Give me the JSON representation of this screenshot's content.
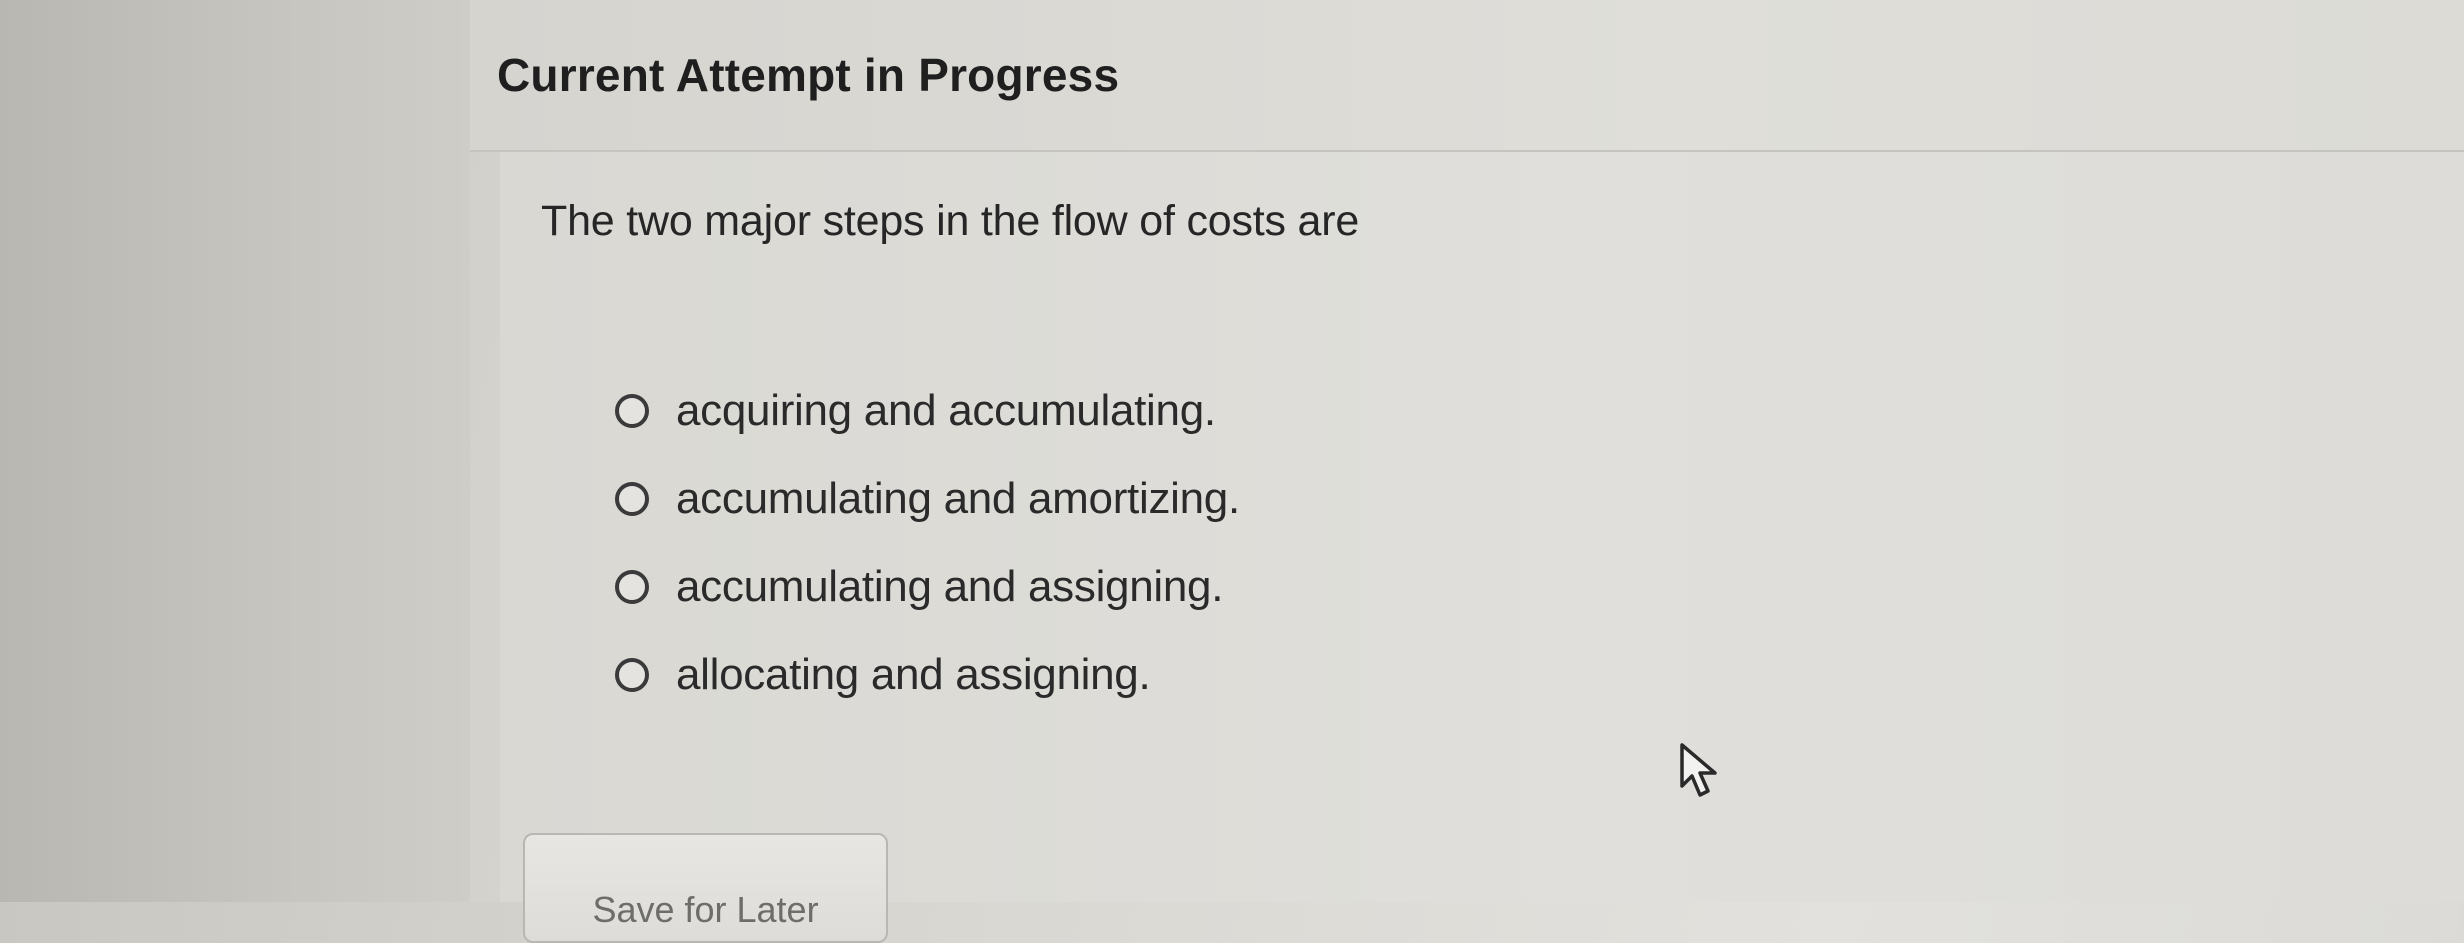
{
  "header": {
    "title": "Current Attempt in Progress"
  },
  "question": {
    "prompt": "The two major steps in the flow of costs are",
    "options": [
      {
        "label": "acquiring and accumulating."
      },
      {
        "label": "accumulating and amortizing."
      },
      {
        "label": "accumulating and assigning."
      },
      {
        "label": "allocating and assigning."
      }
    ]
  },
  "actions": {
    "save_label": "Save for Later"
  },
  "icons": {
    "pointer": "mouse-pointer-icon",
    "radio": "radio-button-icon"
  }
}
